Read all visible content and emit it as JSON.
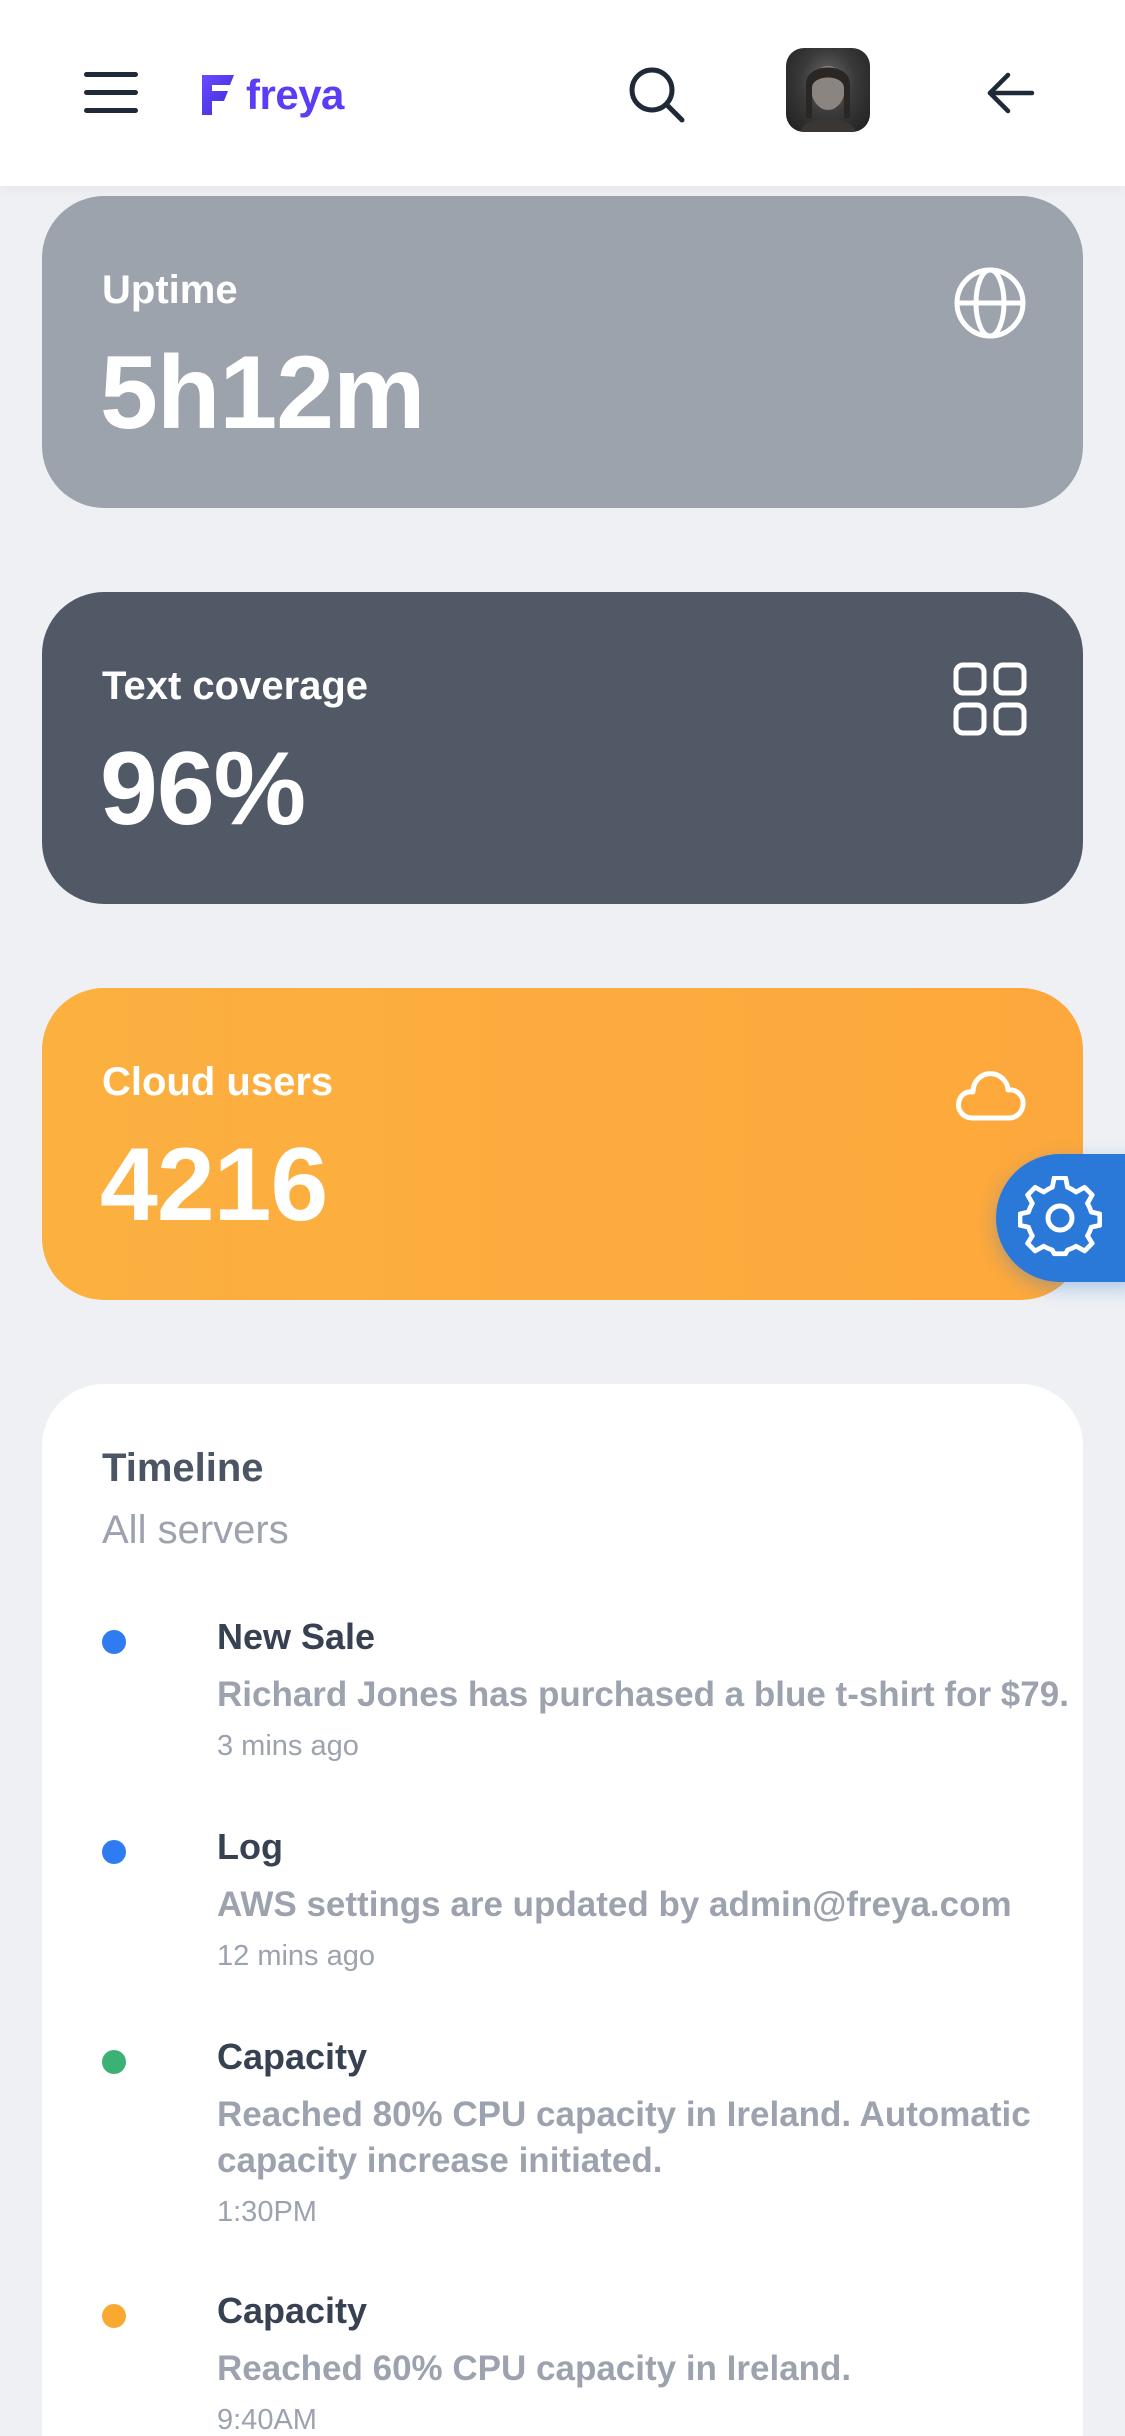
{
  "app": {
    "brand": "freya"
  },
  "colors": {
    "accent": "#2a78d8",
    "brand": "#5b3df5",
    "uptime_card": "#9ca3ac",
    "coverage_card": "#515866",
    "cloud_card": "#fca93d",
    "dot_blue": "#2f7bf2",
    "dot_green": "#3bb273",
    "dot_orange": "#f9a932"
  },
  "header": {
    "menu_icon": "hamburger-icon",
    "search_icon": "search-icon",
    "back_icon": "arrow-left-icon"
  },
  "stats": {
    "uptime": {
      "label": "Uptime",
      "value": "5h12m",
      "icon": "globe-icon"
    },
    "coverage": {
      "label": "Text coverage",
      "value": "96%",
      "icon": "grid-icon"
    },
    "cloud": {
      "label": "Cloud users",
      "value": "4216",
      "icon": "cloud-icon"
    }
  },
  "fab": {
    "icon": "gear-icon"
  },
  "timeline": {
    "title": "Timeline",
    "subtitle": "All servers",
    "items": [
      {
        "name": "New Sale",
        "desc": "Richard Jones has purchased a blue t-shirt for $79.",
        "time": "3 mins ago",
        "dot": "#2f7bf2"
      },
      {
        "name": "Log",
        "desc": "AWS settings are updated by admin@freya.com",
        "time": "12 mins ago",
        "dot": "#2f7bf2"
      },
      {
        "name": "Capacity",
        "desc": "Reached 80% CPU capacity in Ireland. Automatic capacity increase initiated.",
        "time": "1:30PM",
        "dot": "#3bb273"
      },
      {
        "name": "Capacity",
        "desc": "Reached 60% CPU capacity in Ireland.",
        "time": "9:40AM",
        "dot": "#f9a932"
      }
    ]
  }
}
